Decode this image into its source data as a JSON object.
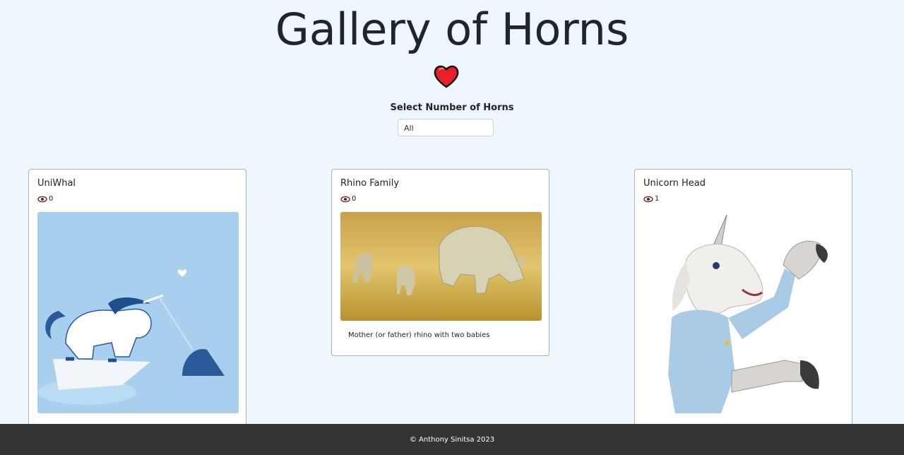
{
  "page": {
    "title": "Gallery of Horns"
  },
  "filter": {
    "label": "Select Number of Horns",
    "selected": "All"
  },
  "cards": [
    {
      "title": "UniWhal",
      "views": "0",
      "description": ""
    },
    {
      "title": "Rhino Family",
      "views": "0",
      "description": "Mother (or father) rhino with two babies"
    },
    {
      "title": "Unicorn Head",
      "views": "1",
      "description": ""
    }
  ],
  "footer": {
    "text": "© Anthony Sinitsa 2023"
  },
  "colors": {
    "background": "#eef6fe",
    "footer": "#343434",
    "heart": "#e8202a"
  }
}
